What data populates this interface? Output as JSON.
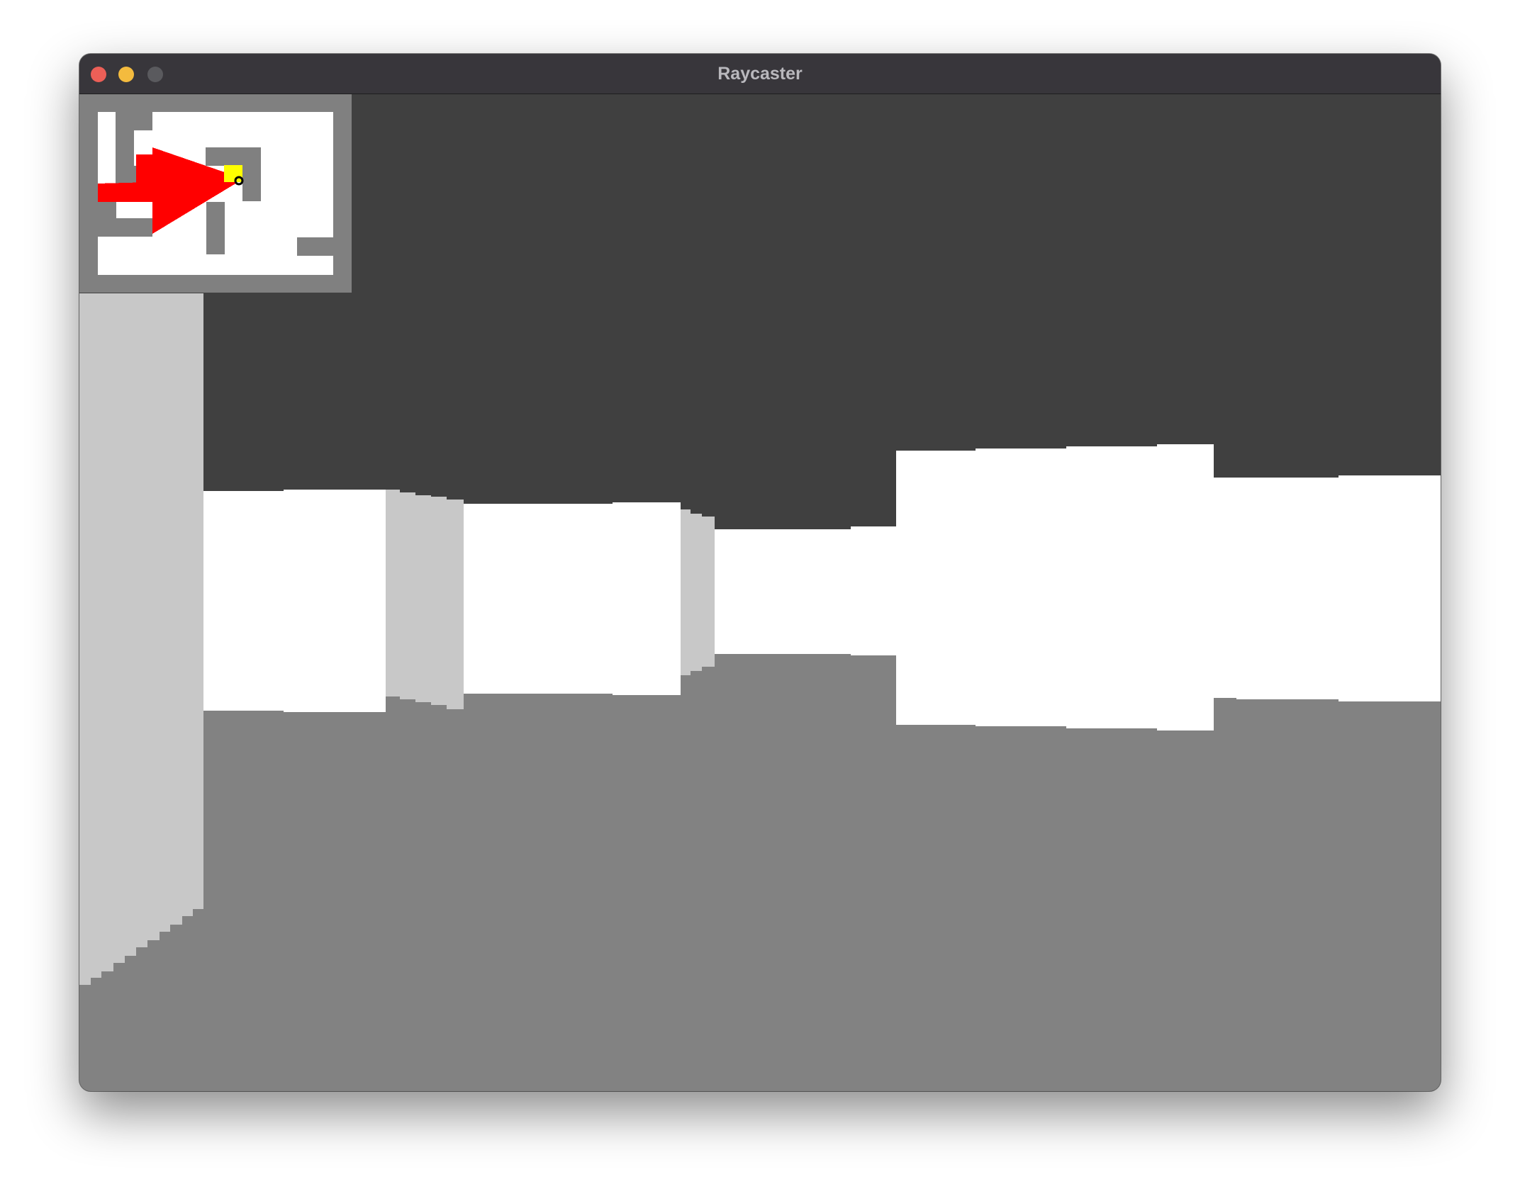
{
  "window": {
    "title": "Raycaster"
  },
  "colors": {
    "ceiling": "#404040",
    "floor": "#828282",
    "wall_lit": "#ffffff",
    "wall_shade": "#c8c8c8",
    "minimap_wall": "#808080",
    "minimap_floor": "#ffffff",
    "player_marker": "#ffff00",
    "view_cone": "#ff0000"
  },
  "icons": {
    "close": "close-button-icon",
    "minimize": "minimize-button-icon",
    "maximize": "maximize-button-icon",
    "player": "player-marker-icon"
  }
}
